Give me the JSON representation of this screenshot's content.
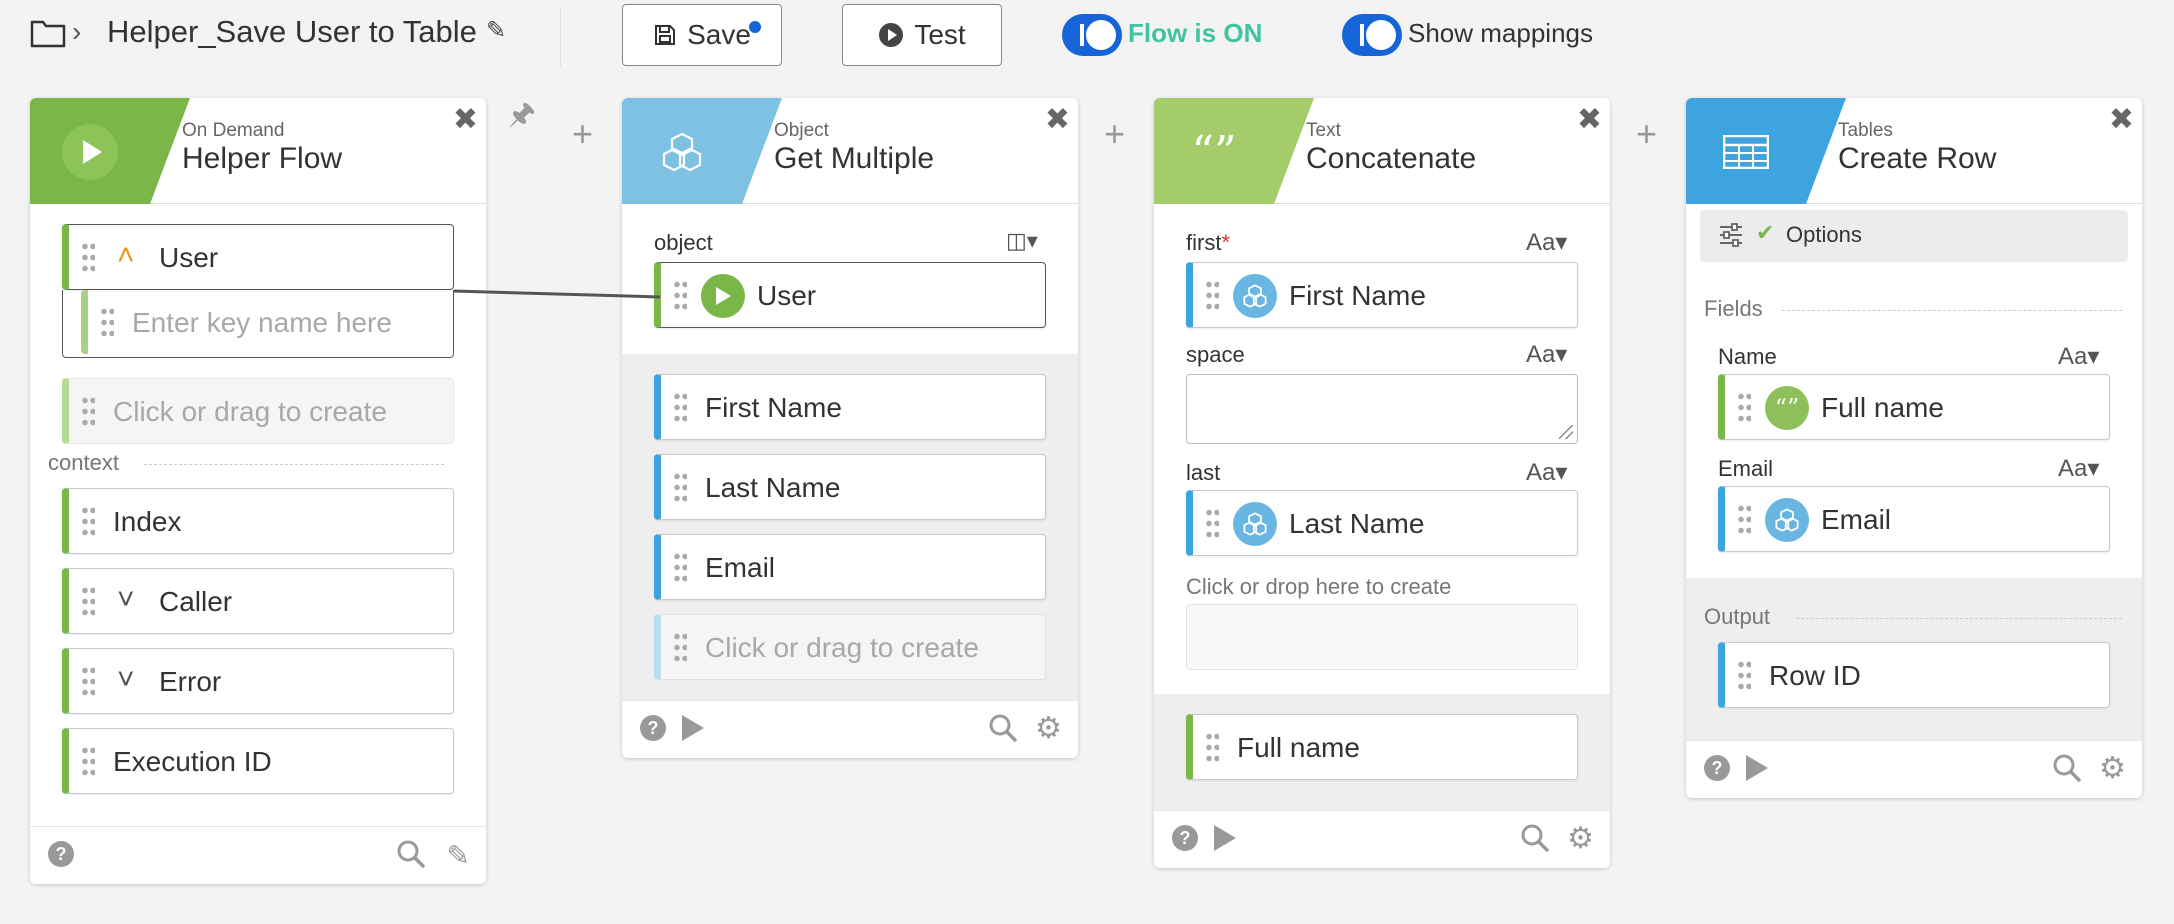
{
  "header": {
    "flow_title": "Helper_Save User to Table",
    "save_label": "Save",
    "test_label": "Test",
    "flow_toggle_label": "Flow is ON",
    "mappings_toggle_label": "Show mappings"
  },
  "colors": {
    "accent_blue": "#1565d8",
    "flow_on_teal": "#3fc3a1",
    "trigger_green": "#7ab648",
    "object_blue": "#7fc1e3",
    "text_green": "#a4cc6a",
    "tables_blue": "#3ea4e0"
  },
  "cards": {
    "helper": {
      "category": "On Demand",
      "title": "Helper Flow",
      "user_label": "User",
      "key_placeholder": "Enter key name here",
      "create_placeholder": "Click or drag to create",
      "context_label": "context",
      "fields": [
        "Index",
        "Caller",
        "Error",
        "Execution ID"
      ]
    },
    "object": {
      "category": "Object",
      "title": "Get Multiple",
      "input_label": "object",
      "input_value": "User",
      "fields": [
        "First Name",
        "Last Name",
        "Email"
      ],
      "create_placeholder": "Click or drag to create"
    },
    "text": {
      "category": "Text",
      "title": "Concatenate",
      "first_label": "first",
      "required_mark": "*",
      "first_value": "First Name",
      "space_label": "space",
      "last_label": "last",
      "last_value": "Last Name",
      "drop_label": "Click or drop here to create",
      "output_value": "Full name",
      "type_label": "Aa"
    },
    "tables": {
      "category": "Tables",
      "title": "Create Row",
      "options_label": "Options",
      "fields_label": "Fields",
      "name_label": "Name",
      "name_value": "Full name",
      "email_label": "Email",
      "email_value": "Email",
      "output_label": "Output",
      "output_value": "Row ID",
      "type_label": "Aa"
    }
  }
}
